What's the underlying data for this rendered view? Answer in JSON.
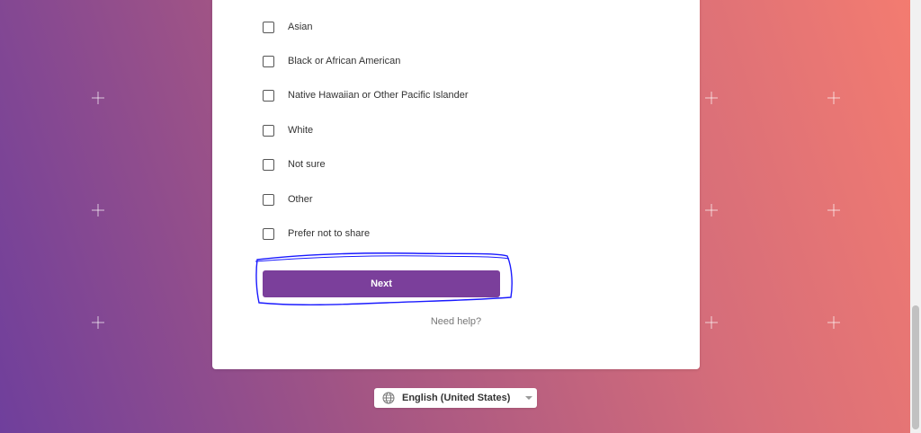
{
  "options": [
    {
      "label": "Asian",
      "checked": false
    },
    {
      "label": "Black or African American",
      "checked": false
    },
    {
      "label": "Native Hawaiian or Other Pacific Islander",
      "checked": false
    },
    {
      "label": "White",
      "checked": false
    },
    {
      "label": "Not sure",
      "checked": false
    },
    {
      "label": "Other",
      "checked": false
    },
    {
      "label": "Prefer not to share",
      "checked": false
    }
  ],
  "next_button": {
    "label": "Next"
  },
  "help": {
    "label": "Need help?"
  },
  "language": {
    "label": "English (United States)",
    "icon": "globe-icon"
  },
  "colors": {
    "accent": "#7b3f9b",
    "annotation": "#1a1aff"
  }
}
